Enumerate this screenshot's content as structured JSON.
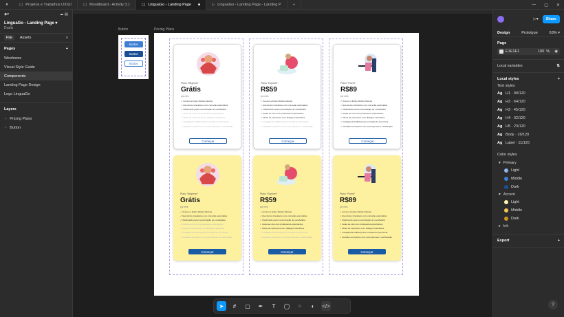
{
  "tabs": [
    {
      "label": "Projetos e Trabalhos UX/UI",
      "active": false
    },
    {
      "label": "Moodboard - Activity 3.1",
      "active": false
    },
    {
      "label": "LinguaGo - Landing Page",
      "active": true
    },
    {
      "label": "LinguaGo - Landing Page - Landing P",
      "active": false
    }
  ],
  "left": {
    "file_title": "LinguaGo - Landing Page",
    "file_sub": "Drafts",
    "tab_file": "File",
    "tab_assets": "Assets",
    "pages_label": "Pages",
    "pages": [
      "Wireframe",
      "Visual Style Guide",
      "Components",
      "Landing Page Design",
      "Logo LinguaGo"
    ],
    "layers_label": "Layers",
    "layers": [
      "Pricing Plans",
      "Button"
    ]
  },
  "right": {
    "share": "Share",
    "tab_design": "Design",
    "tab_prototype": "Prototype",
    "zoom": "63%",
    "page_label": "Page",
    "page_color": "E1E1E1",
    "page_opacity": "100",
    "page_opacity_unit": "%",
    "local_variables": "Local variables",
    "local_styles": "Local styles",
    "text_styles_label": "Text styles",
    "text_styles": [
      {
        "name": "H1 · 90/120"
      },
      {
        "name": "H2 · 64/120"
      },
      {
        "name": "H3 · 45/120"
      },
      {
        "name": "H4 · 32/120"
      },
      {
        "name": "H5 · 23/120"
      },
      {
        "name": "Body · 16/120"
      },
      {
        "name": "Label · 11/120"
      }
    ],
    "color_styles_label": "Color styles",
    "groups": [
      {
        "name": "Primary",
        "items": [
          {
            "name": "Light",
            "color": "#8fb6ea"
          },
          {
            "name": "Middle",
            "color": "#3e7fd3"
          },
          {
            "name": "Dark",
            "color": "#1a4f95"
          }
        ]
      },
      {
        "name": "Accent",
        "items": [
          {
            "name": "Light",
            "color": "#fdf3b0"
          },
          {
            "name": "Middle",
            "color": "#f4c75c"
          },
          {
            "name": "Dark",
            "color": "#c99520"
          }
        ]
      }
    ],
    "ink_label": "Ink",
    "export_label": "Export"
  },
  "canvas": {
    "button_frame_label": "Button",
    "pricing_frame_label": "Pricing Plans",
    "buttons": [
      "Button",
      "Button",
      "Button"
    ],
    "cards": [
      {
        "plan": "Plano “Beginner”",
        "price": "Grátis",
        "per": "por mês",
        "cta": "Começar",
        "style": "white",
        "features": [
          {
            "text": "Acesso a lições diárias básicas",
            "on": true
          },
          {
            "text": "Exercícios interativos com correção automática",
            "on": true
          },
          {
            "text": "Flashcards para memorização de vocabulário",
            "on": true
          },
          {
            "text": "Aulas ao vivo com professores experientes",
            "on": false
          },
          {
            "text": "Mesa de interesses com diálogos interativos",
            "on": false
          },
          {
            "text": "Inteligência Artificial para correção de pronúncia",
            "on": false
          },
          {
            "text": "Desafios exclusivos com recompensas e certificação",
            "on": false
          }
        ]
      },
      {
        "plan": "Plano “Explorer”",
        "price": "R$59",
        "per": "por mês",
        "cta": "Começar",
        "style": "white",
        "features": [
          {
            "text": "Acesso a lições diárias básicas",
            "on": true
          },
          {
            "text": "Exercícios interativos com correção automática",
            "on": true
          },
          {
            "text": "Flashcards para memorização de vocabulário",
            "on": true
          },
          {
            "text": "Aulas ao vivo com professores experientes",
            "on": true
          },
          {
            "text": "Mesa de interesses com diálogos interativos",
            "on": true
          },
          {
            "text": "Inteligência Artificial para correção de pronúncia",
            "on": false
          },
          {
            "text": "Desafios exclusivos com recompensas e certificação",
            "on": false
          }
        ]
      },
      {
        "plan": "Plano “Fluent”",
        "price": "R$89",
        "per": "por mês",
        "cta": "Começar",
        "style": "white",
        "features": [
          {
            "text": "Acesso a lições diárias básicas",
            "on": true
          },
          {
            "text": "Exercícios interativos com correção automática",
            "on": true
          },
          {
            "text": "Flashcards para memorização de vocabulário",
            "on": true
          },
          {
            "text": "Aulas ao vivo com professores experientes",
            "on": true
          },
          {
            "text": "Mesa de interesses com diálogos interativos",
            "on": true
          },
          {
            "text": "Inteligência Artificial para correção de pronúncia",
            "on": true
          },
          {
            "text": "Desafios exclusivos com recompensas e certificação",
            "on": true
          }
        ]
      },
      {
        "plan": "Plano “Beginner”",
        "price": "Grátis",
        "per": "por mês",
        "cta": "Começar",
        "style": "yellow",
        "features": [
          {
            "text": "Acesso a lições diárias básicas",
            "on": true
          },
          {
            "text": "Exercícios interativos com correção automática",
            "on": true
          },
          {
            "text": "Flashcards para memorização de vocabulário",
            "on": true
          },
          {
            "text": "Aulas ao vivo com professores experientes",
            "on": false
          },
          {
            "text": "Mesa de interesses com diálogos interativos",
            "on": false
          },
          {
            "text": "Inteligência Artificial para correção de pronúncia",
            "on": false
          },
          {
            "text": "Desafios exclusivos com recompensas e certificação",
            "on": false
          }
        ]
      },
      {
        "plan": "Plano “Explorer”",
        "price": "R$59",
        "per": "por mês",
        "cta": "Começar",
        "style": "yellow",
        "features": [
          {
            "text": "Acesso a lições diárias básicas",
            "on": true
          },
          {
            "text": "Exercícios interativos com correção automática",
            "on": true
          },
          {
            "text": "Flashcards para memorização de vocabulário",
            "on": true
          },
          {
            "text": "Aulas ao vivo com professores experientes",
            "on": true
          },
          {
            "text": "Mesa de interesses com diálogos interativos",
            "on": true
          },
          {
            "text": "Inteligência Artificial para correção de pronúncia",
            "on": false
          },
          {
            "text": "Desafios exclusivos com recompensas e certificação",
            "on": false
          }
        ]
      },
      {
        "plan": "Plano “Fluent”",
        "price": "R$89",
        "per": "por mês",
        "cta": "Começar",
        "style": "yellow",
        "features": [
          {
            "text": "Acesso a lições diárias básicas",
            "on": true
          },
          {
            "text": "Exercícios interativos com correção automática",
            "on": true
          },
          {
            "text": "Flashcards para memorização de vocabulário",
            "on": true
          },
          {
            "text": "Aulas ao vivo com professores experientes",
            "on": true
          },
          {
            "text": "Mesa de interesses com diálogos interativos",
            "on": true
          },
          {
            "text": "Inteligência Artificial para correção de pronúncia",
            "on": true
          },
          {
            "text": "Desafios exclusivos com recompensas e certificação",
            "on": true
          }
        ]
      }
    ]
  },
  "toolbar": {
    "tools": [
      "move-tool",
      "frame-tool",
      "shape-tool",
      "pen-tool",
      "text-tool",
      "comment-tool",
      "actions-tool",
      "dev-mode-toggle"
    ]
  },
  "help": "?"
}
